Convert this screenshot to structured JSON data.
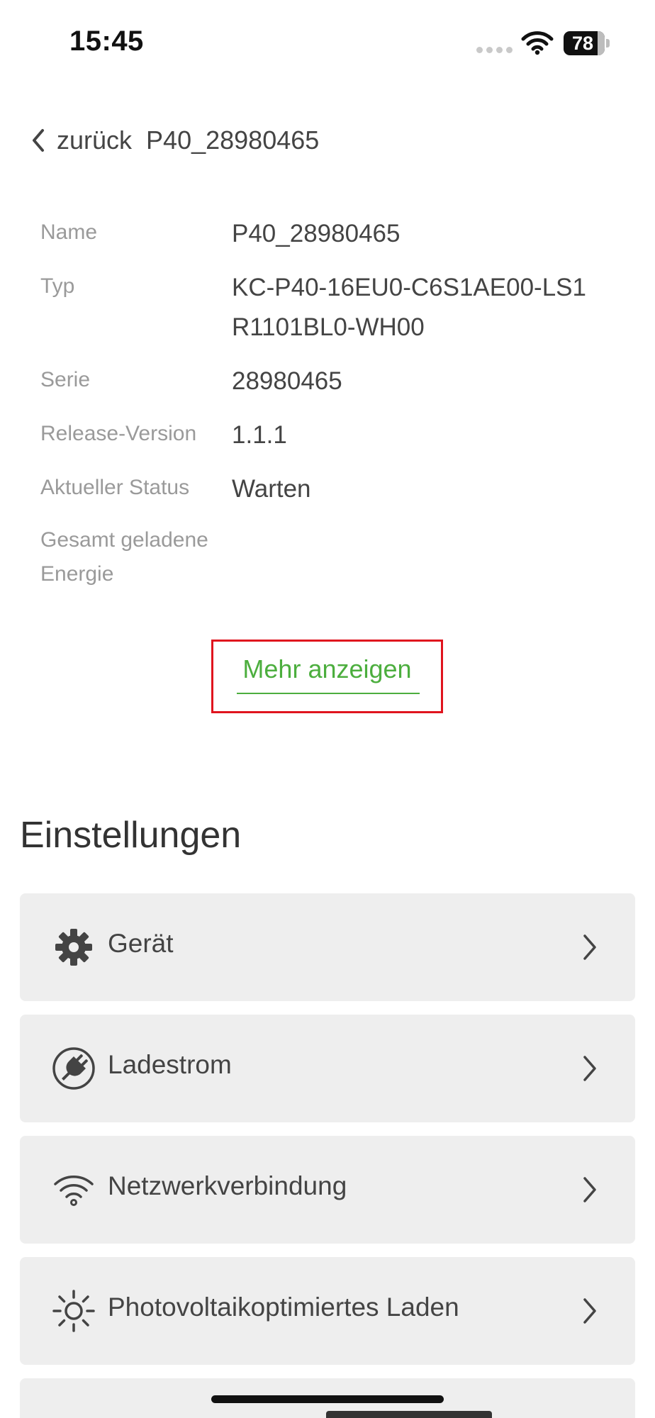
{
  "status_bar": {
    "time": "15:45",
    "battery": "78"
  },
  "nav": {
    "back_label": "zurück",
    "title": "P40_28980465"
  },
  "info": [
    {
      "label": "Name",
      "value": "P40_28980465"
    },
    {
      "label": "Typ",
      "value": "KC-P40-16EU0-C6S1AE00-LS1 R1101BL0-WH00"
    },
    {
      "label": "Serie",
      "value": "28980465"
    },
    {
      "label": "Release-Version",
      "value": "1.1.1"
    },
    {
      "label": "Aktueller Status",
      "value": "Warten"
    },
    {
      "label": "Gesamt geladene Energie",
      "value": ""
    }
  ],
  "more_button": {
    "label": "Mehr anzeigen",
    "highlight_color": "#e0141e",
    "link_color": "#4cae3e"
  },
  "settings": {
    "title": "Einstellungen",
    "items": [
      {
        "label": "Gerät",
        "icon": "gear-icon"
      },
      {
        "label": "Ladestrom",
        "icon": "plug-icon"
      },
      {
        "label": "Netzwerkverbindung",
        "icon": "wifi-icon"
      },
      {
        "label": "Photovoltaikoptimiertes Laden",
        "icon": "sun-icon"
      }
    ]
  }
}
